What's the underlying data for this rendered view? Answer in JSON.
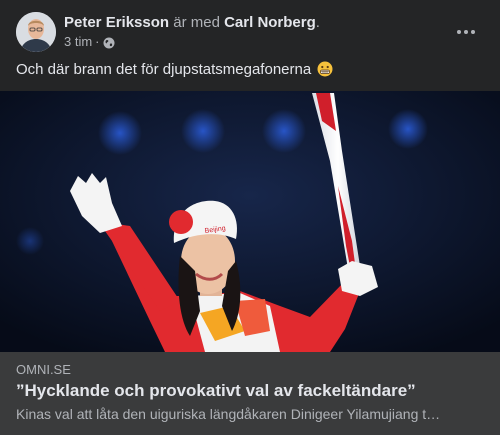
{
  "post": {
    "author": "Peter Eriksson",
    "with_text": "är med",
    "tagged": "Carl Norberg",
    "tagged_suffix": ".",
    "time": "3 tim",
    "separator": "·",
    "privacy_icon": "globe-icon",
    "more_icon": "more-options-icon",
    "text": "Och där brann det för djupstatsmegafonerna",
    "emoji": "grimacing-face-emoji"
  },
  "link": {
    "domain": "OMNI.SE",
    "headline": "”Hycklande och provokativt val av fackeltändare”",
    "description": "Kinas val att låta den uiguriska längdåkaren Dinigeer Yilamujiang t…"
  },
  "colors": {
    "background": "#242526",
    "link_box": "#3a3b3c",
    "primary_text": "#e4e6eb",
    "secondary_text": "#b0b3b8"
  }
}
